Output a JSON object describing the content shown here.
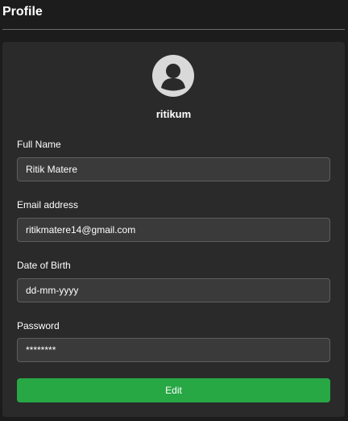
{
  "page": {
    "title": "Profile"
  },
  "profile": {
    "avatar_icon": "user-circle-icon",
    "username": "ritikum"
  },
  "form": {
    "full_name": {
      "label": "Full Name",
      "value": "Ritik Matere"
    },
    "email": {
      "label": "Email address",
      "value": "ritikmatere14@gmail.com"
    },
    "dob": {
      "label": "Date of Birth",
      "placeholder": "dd-mm-yyyy"
    },
    "password": {
      "label": "Password",
      "value": "********"
    },
    "edit_label": "Edit"
  },
  "colors": {
    "background": "#1c1c1c",
    "card": "#2a2a2a",
    "input_bg": "#3a3a3a",
    "input_border": "#5e5e5e",
    "accent_green": "#28a745",
    "avatar": "#d9d9d9"
  }
}
